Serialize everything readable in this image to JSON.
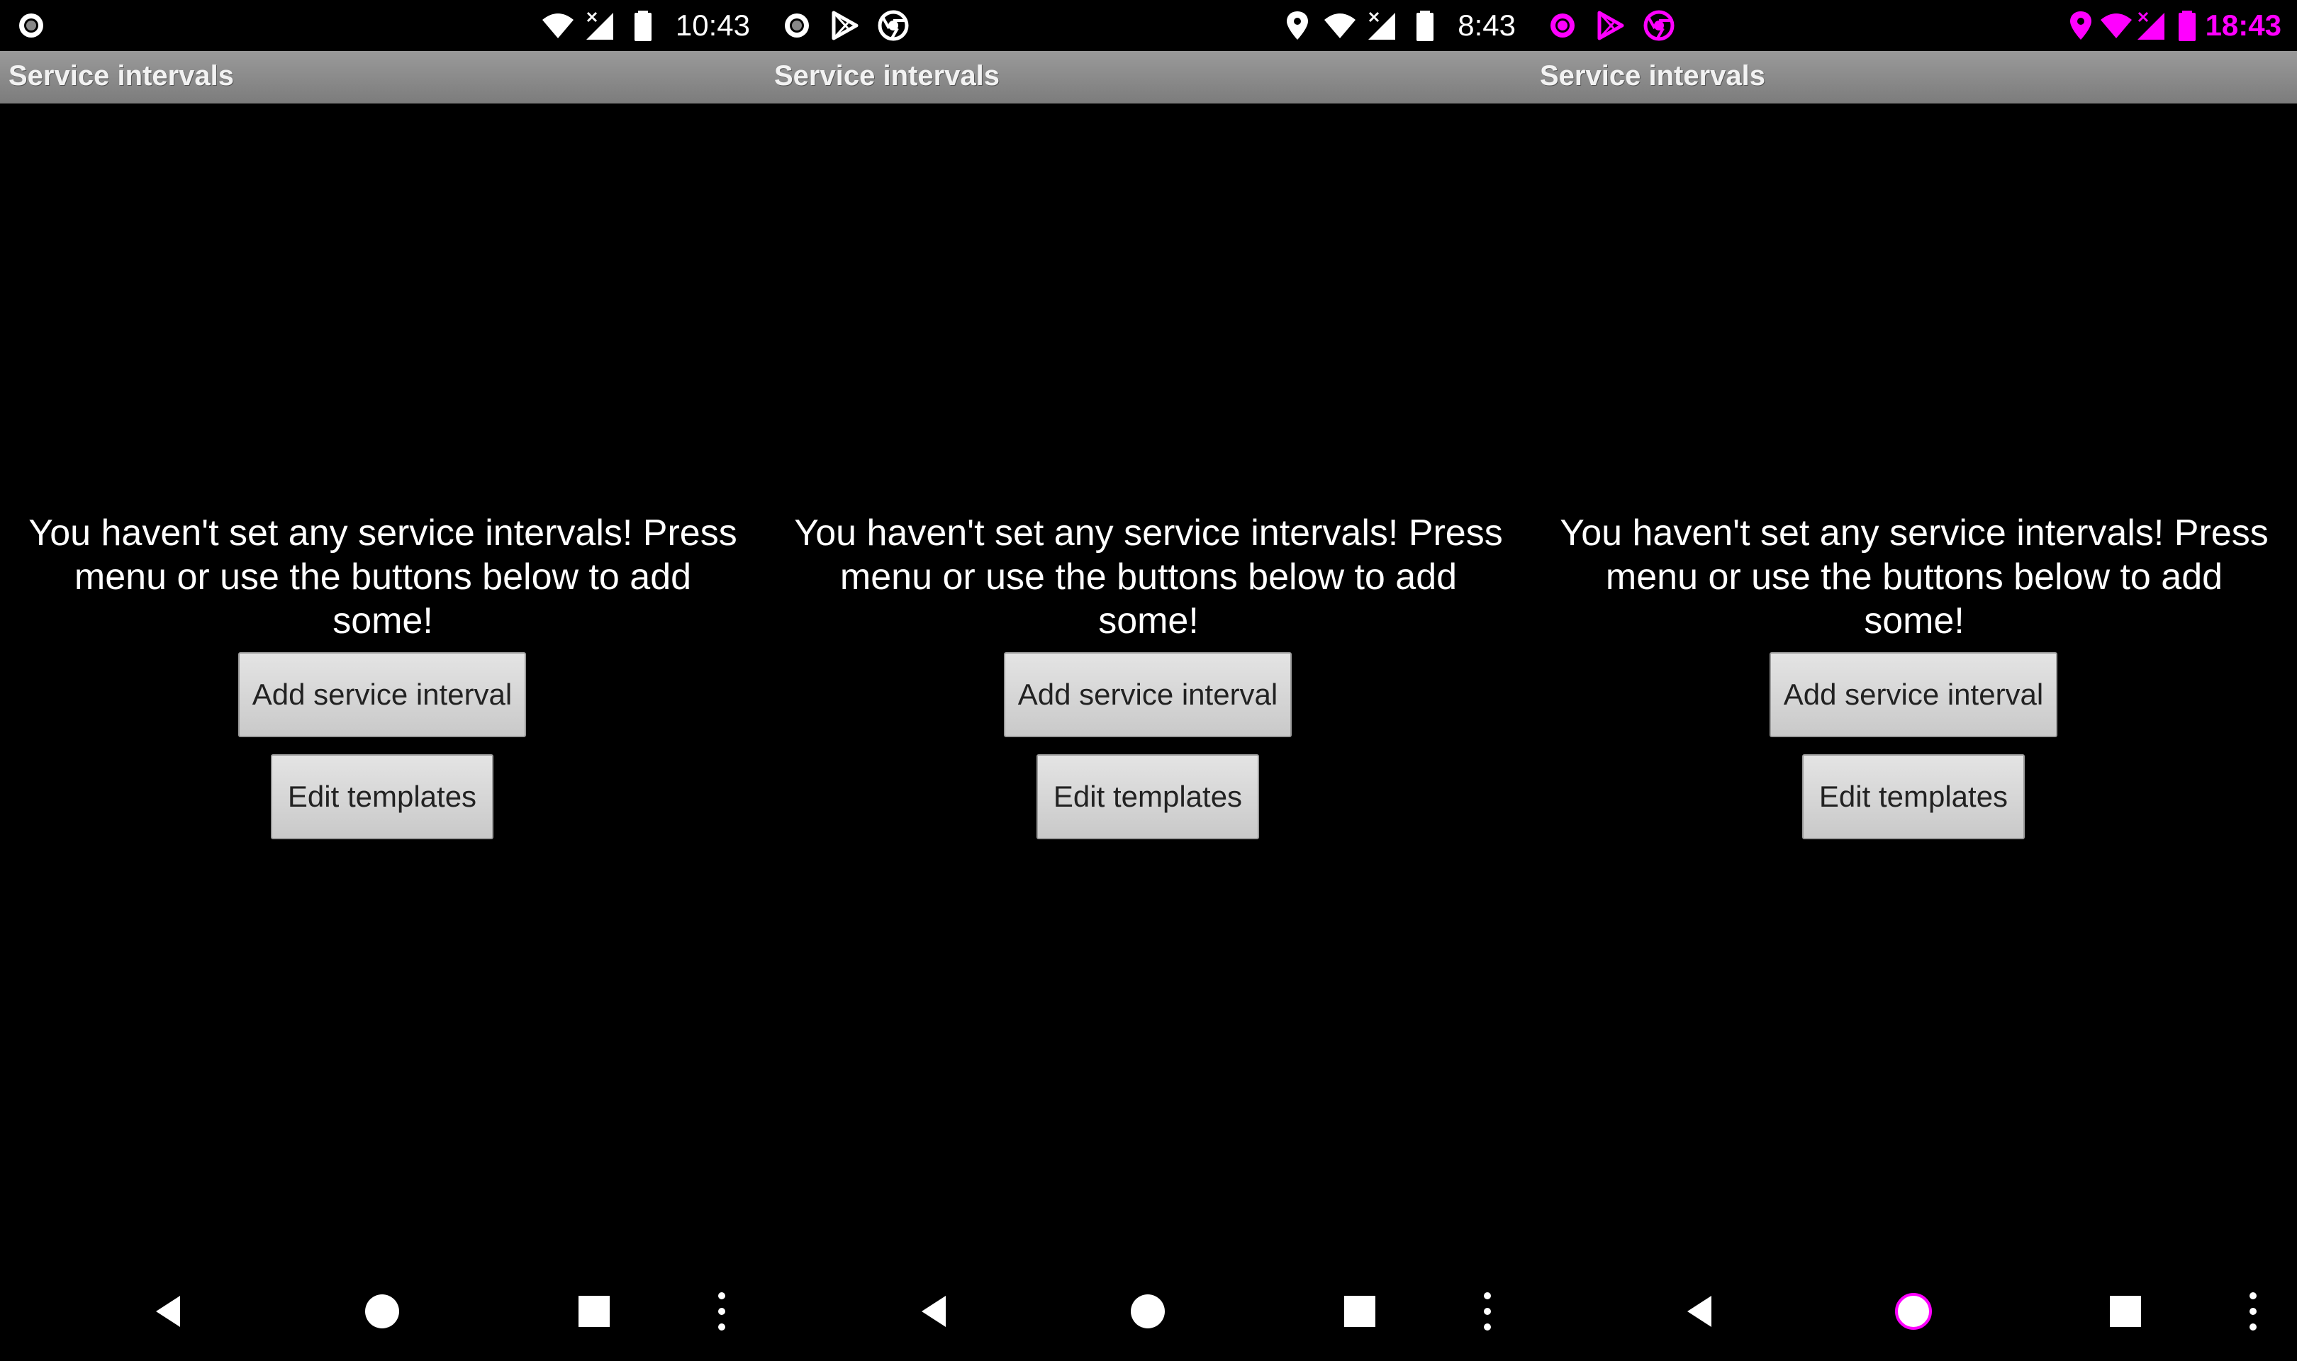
{
  "screens": [
    {
      "status_bar": {
        "time": "10:43",
        "left_icons": [
          "circle-record-icon"
        ],
        "right_icons": [
          "wifi-icon",
          "signal-no-service-icon",
          "battery-icon"
        ],
        "icon_color": "#ffffff"
      },
      "title": "Service intervals",
      "empty_message": "You haven't set any service intervals! Press menu or use the buttons below to add some!",
      "buttons": {
        "add_label": "Add service interval",
        "edit_label": "Edit templates"
      },
      "nav": [
        "back-icon",
        "home-icon",
        "recents-icon",
        "overflow-menu-icon"
      ]
    },
    {
      "status_bar": {
        "time": "8:43",
        "left_icons": [
          "circle-record-icon",
          "play-store-icon",
          "chrome-icon"
        ],
        "right_icons": [
          "location-icon",
          "wifi-icon",
          "signal-no-service-icon",
          "battery-icon"
        ],
        "icon_color": "#ffffff"
      },
      "title": "Service intervals",
      "empty_message": "You haven't set any service intervals! Press menu or use the buttons below to add some!",
      "buttons": {
        "add_label": "Add service interval",
        "edit_label": "Edit templates"
      },
      "nav": [
        "back-icon",
        "home-icon",
        "recents-icon",
        "overflow-menu-icon"
      ]
    },
    {
      "status_bar": {
        "time": "18:43",
        "left_icons": [
          "circle-record-icon",
          "play-store-icon",
          "chrome-icon"
        ],
        "right_icons": [
          "location-icon",
          "wifi-icon",
          "signal-no-service-icon",
          "battery-icon"
        ],
        "icon_color": "#ff00ff"
      },
      "title": "Service intervals",
      "empty_message": "You haven't set any service intervals! Press menu or use the buttons below to add some!",
      "buttons": {
        "add_label": "Add service interval",
        "edit_label": "Edit templates"
      },
      "nav": [
        "back-icon",
        "home-icon",
        "recents-icon",
        "overflow-menu-icon"
      ]
    }
  ],
  "colors": {
    "background": "#000000",
    "title_bar": "#8a8a8a",
    "button": "#d6d6d6",
    "accent_magenta": "#ff00ff"
  }
}
